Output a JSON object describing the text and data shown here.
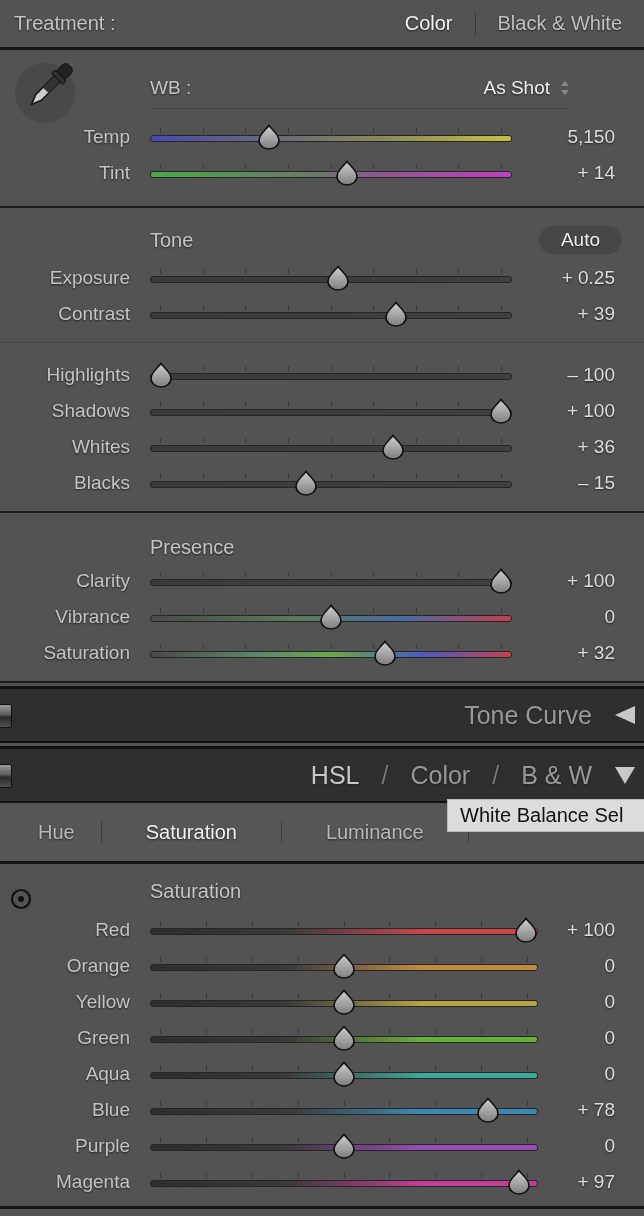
{
  "treatment": {
    "label": "Treatment :",
    "options": [
      {
        "label": "Color",
        "selected": true
      },
      {
        "label": "Black & White",
        "selected": false
      }
    ]
  },
  "basic": {
    "wb_label": "WB :",
    "wb_value": "As Shot",
    "wb_sliders": [
      {
        "label": "Temp",
        "kind": "temp",
        "level": 0.33,
        "reading": "5,150"
      },
      {
        "label": "Tint",
        "kind": "tint",
        "level": 0.545,
        "reading": "+ 14"
      }
    ],
    "tone_title": "Tone",
    "auto_button": "Auto",
    "tone_sliders": [
      {
        "label": "Exposure",
        "kind": "plain",
        "level": 0.52,
        "reading": "+ 0.25"
      },
      {
        "label": "Contrast",
        "kind": "plain",
        "level": 0.68,
        "reading": "+ 39"
      }
    ],
    "range_sliders": [
      {
        "label": "Highlights",
        "kind": "plain",
        "level": 0.03,
        "reading": "– 100"
      },
      {
        "label": "Shadows",
        "kind": "plain",
        "level": 0.97,
        "reading": "+ 100"
      },
      {
        "label": "Whites",
        "kind": "plain",
        "level": 0.67,
        "reading": "+ 36"
      },
      {
        "label": "Blacks",
        "kind": "plain",
        "level": 0.43,
        "reading": "– 15"
      }
    ],
    "presence_title": "Presence",
    "presence_sliders": [
      {
        "label": "Clarity",
        "kind": "plain",
        "level": 0.97,
        "reading": "+ 100"
      },
      {
        "label": "Vibrance",
        "kind": "vibrance",
        "level": 0.5,
        "reading": "0"
      },
      {
        "label": "Saturation",
        "kind": "saturation",
        "level": 0.65,
        "reading": "+ 32"
      }
    ]
  },
  "panel_headers": [
    {
      "tabs": [
        {
          "label": "Tone Curve",
          "selected": false
        }
      ],
      "expanded": false,
      "on": true
    },
    {
      "tabs": [
        {
          "label": "HSL",
          "selected": true
        },
        {
          "label": "Color",
          "selected": false
        },
        {
          "label": "B & W",
          "selected": false
        }
      ],
      "separator": "/",
      "expanded": true,
      "on": true
    }
  ],
  "hsl": {
    "tabs": [
      {
        "label": "Hue",
        "selected": false
      },
      {
        "label": "Saturation",
        "selected": true
      },
      {
        "label": "Luminance",
        "selected": false
      }
    ],
    "tooltip": "White Balance Sel",
    "title": "Saturation",
    "sliders": [
      {
        "label": "Red",
        "color": "#c8464e",
        "level": 0.97,
        "reading": "+ 100"
      },
      {
        "label": "Orange",
        "color": "#c48a42",
        "level": 0.5,
        "reading": "0"
      },
      {
        "label": "Yellow",
        "color": "#b4a444",
        "level": 0.5,
        "reading": "0"
      },
      {
        "label": "Green",
        "color": "#6aae3c",
        "level": 0.5,
        "reading": "0"
      },
      {
        "label": "Aqua",
        "color": "#3ca896",
        "level": 0.5,
        "reading": "0"
      },
      {
        "label": "Blue",
        "color": "#3c88b4",
        "level": 0.87,
        "reading": "+ 78"
      },
      {
        "label": "Purple",
        "color": "#9a4cb8",
        "level": 0.5,
        "reading": "0"
      },
      {
        "label": "Magenta",
        "color": "#c43c96",
        "level": 0.95,
        "reading": "+ 97"
      }
    ]
  }
}
